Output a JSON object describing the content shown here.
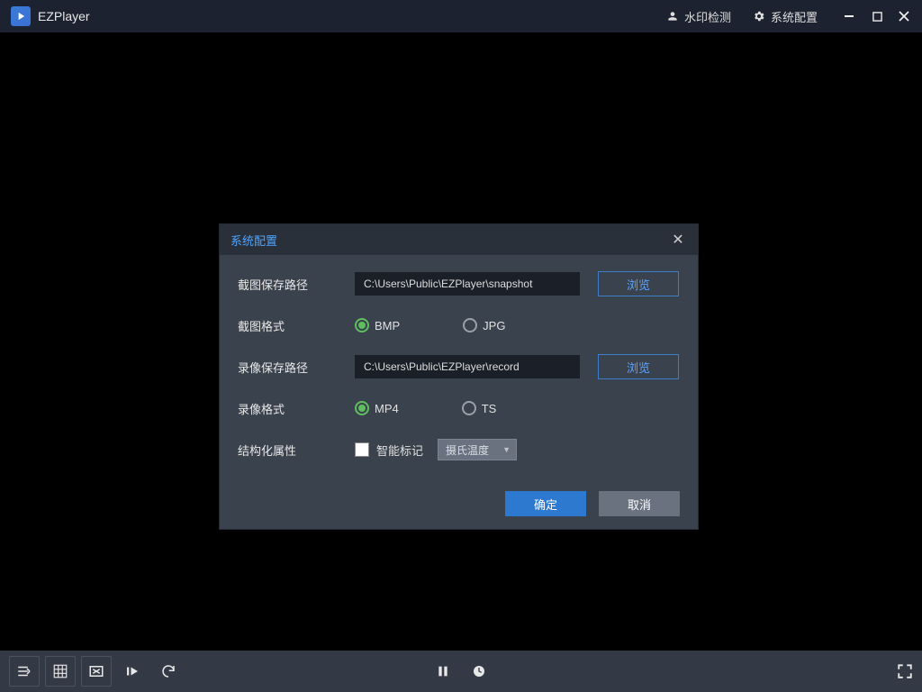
{
  "app": {
    "title": "EZPlayer"
  },
  "titlebar": {
    "watermark_detect": "水印检测",
    "system_config": "系统配置"
  },
  "dialog": {
    "title": "系统配置",
    "rows": {
      "snapshot_path_label": "截图保存路径",
      "snapshot_path_value": "C:\\Users\\Public\\EZPlayer\\snapshot",
      "snapshot_format_label": "截图格式",
      "record_path_label": "录像保存路径",
      "record_path_value": "C:\\Users\\Public\\EZPlayer\\record",
      "record_format_label": "录像格式",
      "struct_attr_label": "结构化属性",
      "smart_mark_label": "智能标记",
      "temp_select": "摄氏温度"
    },
    "radio": {
      "bmp": "BMP",
      "jpg": "JPG",
      "mp4": "MP4",
      "ts": "TS"
    },
    "buttons": {
      "browse": "浏览",
      "ok": "确定",
      "cancel": "取消"
    }
  },
  "colors": {
    "accent": "#3d7ec9",
    "primary_btn": "#2d79d0"
  }
}
